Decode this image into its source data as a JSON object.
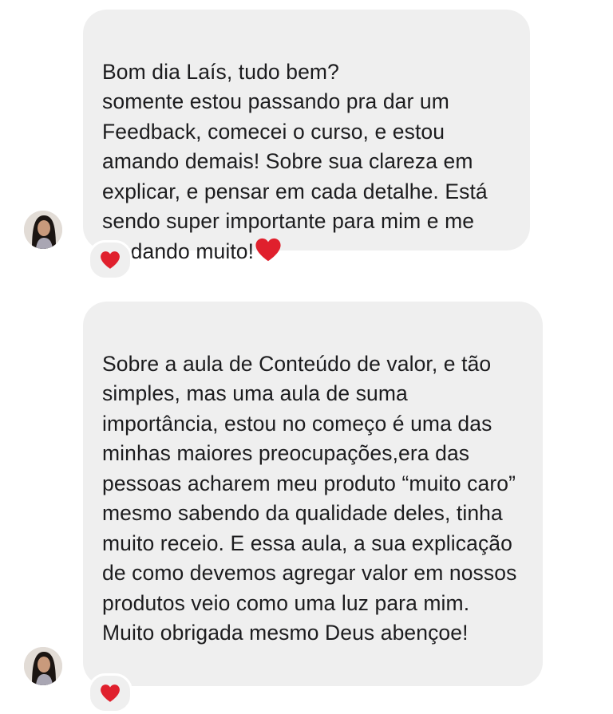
{
  "conversation": {
    "messages": [
      {
        "text": "Bom dia Laís, tudo bem?\nsomente estou passando pra dar um Feedback, comecei o curso, e estou amando demais! Sobre sua clareza em explicar, e pensar em cada detalhe. Está sendo super importante para mim e me ajudando muito!",
        "inline_emoji": "heart-icon",
        "reaction": "heart-icon"
      },
      {
        "text": "Sobre a aula de Conteúdo de valor, e tão simples, mas uma aula de suma importância, estou no começo é uma das minhas maiores preocupações,era das pessoas acharem meu produto “muito caro” mesmo sabendo da qualidade deles, tinha muito receio. E essa aula, a sua explicação de como devemos agregar valor em nossos produtos veio como uma luz para mim. Muito obrigada mesmo Deus abençoe!",
        "reaction": "heart-icon"
      }
    ]
  },
  "colors": {
    "bubble": "#efefef",
    "heart": "#e0202d",
    "background": "#ffffff"
  }
}
